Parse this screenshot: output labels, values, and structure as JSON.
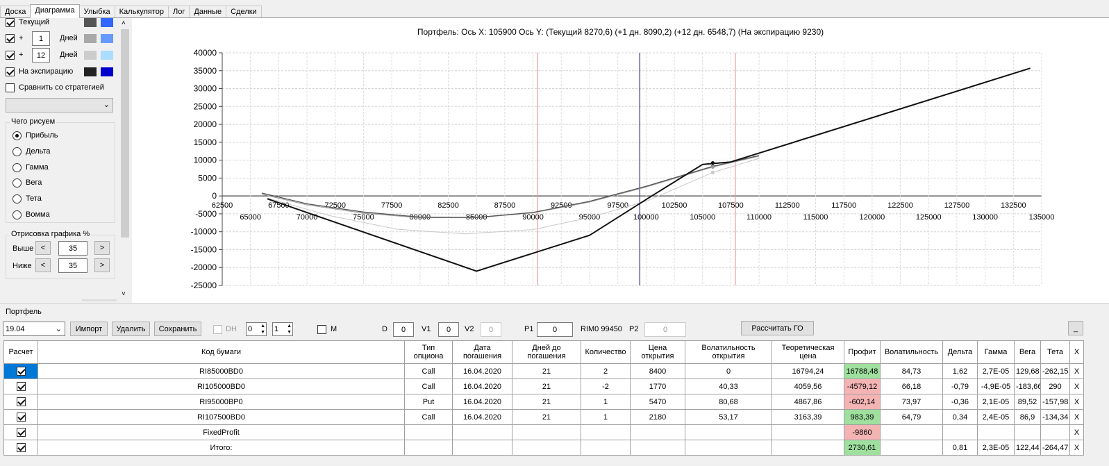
{
  "tabs": [
    "Доска",
    "Диаграмма",
    "Улыбка",
    "Калькулятор",
    "Лог",
    "Данные",
    "Сделки"
  ],
  "active_tab": 1,
  "left_panel": {
    "current_label": "Текущий",
    "plus_sign": "+",
    "days_label": "Дней",
    "days1": "1",
    "days2": "12",
    "expiry_label": "На экспирацию",
    "compare_label": "Сравнить со стратегией",
    "draw_group": "Чего рисуем",
    "draw_options": [
      "Прибыль",
      "Дельта",
      "Гамма",
      "Вега",
      "Тета",
      "Вомма"
    ],
    "render_group": "Отрисовка графика %",
    "above_label": "Выше",
    "below_label": "Ниже",
    "above_value": "35",
    "below_value": "35",
    "lt": "<",
    "gt": ">",
    "swatches": [
      "#555555",
      "#3366ff",
      "#a8a8a8",
      "#6699ff",
      "#cccccc",
      "#aaddff",
      "#222222",
      "#0000cc"
    ]
  },
  "chart_data": {
    "type": "line",
    "title": "Портфель: Ось X: 105900 Ось Y:  (Текущий 8270,6)  (+1 дн. 8090,2)  (+12 дн. 6548,7)  (На экспирацию 9230)",
    "ylim": [
      -25000,
      40000
    ],
    "xlim": [
      62500,
      135000
    ],
    "y_ticks": [
      "40000",
      "35000",
      "30000",
      "25000",
      "20000",
      "15000",
      "10000",
      "5000",
      "0",
      "-5000",
      "-10000",
      "-15000",
      "-20000",
      "-25000"
    ],
    "x_ticks_upper": [
      "62500",
      "67500",
      "72500",
      "77500",
      "82500",
      "87500",
      "92500",
      "97500",
      "102500",
      "107500",
      "112500",
      "117500",
      "122500",
      "127500",
      "132500"
    ],
    "x_ticks_lower": [
      "65000",
      "70000",
      "75000",
      "80000",
      "85000",
      "90000",
      "95000",
      "100000",
      "105000",
      "110000",
      "115000",
      "120000",
      "125000",
      "130000",
      "135000"
    ],
    "vlines": [
      {
        "x": 90400,
        "color": "#e89aa0"
      },
      {
        "x": 99450,
        "color": "#2c2c80"
      },
      {
        "x": 107900,
        "color": "#e89aa0"
      }
    ],
    "series": [
      {
        "color": "#111111",
        "width": 2,
        "x": [
          66500,
          85000,
          95000,
          100500,
          105000,
          106500,
          107500,
          134000
        ],
        "y": [
          -800,
          -21000,
          -11000,
          0,
          8800,
          9230,
          9500,
          35700
        ]
      },
      {
        "color": "#555555",
        "width": 1.3,
        "x": [
          66000,
          70000,
          75000,
          80000,
          85000,
          90000,
          95000,
          100000,
          105900,
          110000
        ],
        "y": [
          800,
          -2200,
          -4500,
          -5900,
          -6000,
          -4600,
          -1500,
          2700,
          8270,
          11300
        ]
      },
      {
        "color": "#999999",
        "width": 1.1,
        "x": [
          66000,
          70000,
          75000,
          80000,
          85000,
          90000,
          95000,
          100000,
          105900,
          110000
        ],
        "y": [
          500,
          -2500,
          -4800,
          -6100,
          -6100,
          -4700,
          -1700,
          2500,
          8090,
          11100
        ]
      },
      {
        "color": "#c8c8c8",
        "width": 1,
        "x": [
          66500,
          72000,
          78000,
          84000,
          90000,
          95000,
          100000,
          105900,
          110000
        ],
        "y": [
          -600,
          -5500,
          -9300,
          -10600,
          -9400,
          -6000,
          -1500,
          6548,
          10500
        ]
      }
    ],
    "marker_x": 105900,
    "markers_y": [
      9230,
      8270,
      8090,
      6548
    ]
  },
  "portfolio": {
    "group_label": "Портфель",
    "date_value": "19.04",
    "import_label": "Импорт",
    "delete_label": "Удалить",
    "save_label": "Сохранить",
    "dh_label": "DH",
    "dh_value1": "0",
    "dh_value2": "1",
    "m_label": "M",
    "d_label": "D",
    "d_value": "0",
    "v1_label": "V1",
    "v1_value": "0",
    "v2_label": "V2",
    "v2_value": "0",
    "p1_label": "P1",
    "p1_value": "0",
    "rim_label": "RIM0 99450",
    "p2_label": "P2",
    "p2_value": "0",
    "calc_go_label": "Рассчитать ГО",
    "minimize_label": "_",
    "columns": [
      "Расчет",
      "Код бумаги",
      "Тип опциона",
      "Дата погашения",
      "Дней до погашения",
      "Количество",
      "Цена открытия",
      "Волатильность открытия",
      "Теоретическая цена",
      "Профит",
      "Волатильность",
      "Дельта",
      "Гамма",
      "Вега",
      "Тета",
      "X"
    ],
    "rows": [
      {
        "code": "RI85000BD0",
        "type": "Call",
        "date": "16.04.2020",
        "days": "21",
        "qty": "2",
        "open": "8400",
        "vol_open": "0",
        "theor": "16794,24",
        "profit": "16788,48",
        "profit_state": "green",
        "vol": "84,73",
        "delta": "1,62",
        "gamma": "2,7E-05",
        "vega": "129,68",
        "theta": "-262,15",
        "x": "X"
      },
      {
        "code": "RI105000BD0",
        "type": "Call",
        "date": "16.04.2020",
        "days": "21",
        "qty": "-2",
        "open": "1770",
        "vol_open": "40,33",
        "theor": "4059,56",
        "profit": "-4579,12",
        "profit_state": "red",
        "vol": "66,18",
        "delta": "-0,79",
        "gamma": "-4,9E-05",
        "vega": "-183,66",
        "theta": "290",
        "x": "X"
      },
      {
        "code": "RI95000BP0",
        "type": "Put",
        "date": "16.04.2020",
        "days": "21",
        "qty": "1",
        "open": "5470",
        "vol_open": "80,68",
        "theor": "4867,86",
        "profit": "-602,14",
        "profit_state": "red",
        "vol": "73,97",
        "delta": "-0,36",
        "gamma": "2,1E-05",
        "vega": "89,52",
        "theta": "-157,98",
        "x": "X"
      },
      {
        "code": "RI107500BD0",
        "type": "Call",
        "date": "16.04.2020",
        "days": "21",
        "qty": "1",
        "open": "2180",
        "vol_open": "53,17",
        "theor": "3163,39",
        "profit": "983,39",
        "profit_state": "green",
        "vol": "64,79",
        "delta": "0,34",
        "gamma": "2,4E-05",
        "vega": "86,9",
        "theta": "-134,34",
        "x": "X"
      },
      {
        "code": "FixedProfit",
        "type": "",
        "date": "",
        "days": "",
        "qty": "",
        "open": "",
        "vol_open": "",
        "theor": "",
        "profit": "-9860",
        "profit_state": "red",
        "vol": "",
        "delta": "",
        "gamma": "",
        "vega": "",
        "theta": "",
        "x": "X"
      },
      {
        "code": "Итого:",
        "type": "",
        "date": "",
        "days": "",
        "qty": "",
        "open": "",
        "vol_open": "",
        "theor": "",
        "profit": "2730,61",
        "profit_state": "green",
        "vol": "",
        "delta": "0,81",
        "gamma": "2,3E-05",
        "vega": "122,44",
        "theta": "-264,47",
        "x": "X"
      }
    ]
  }
}
